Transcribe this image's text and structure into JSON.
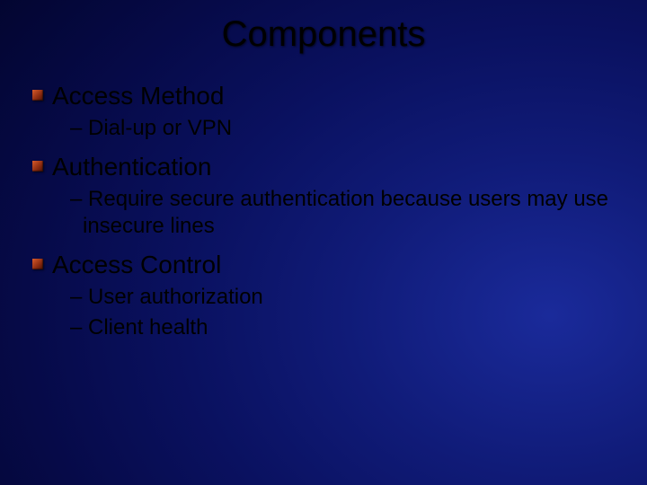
{
  "title": "Components",
  "items": [
    {
      "heading": "Access Method",
      "subs": [
        "Dial-up or VPN"
      ]
    },
    {
      "heading": "Authentication",
      "subs": [
        "Require secure authentication because users may use insecure lines"
      ]
    },
    {
      "heading": "Access Control",
      "subs": [
        "User authorization",
        "Client health"
      ]
    }
  ]
}
